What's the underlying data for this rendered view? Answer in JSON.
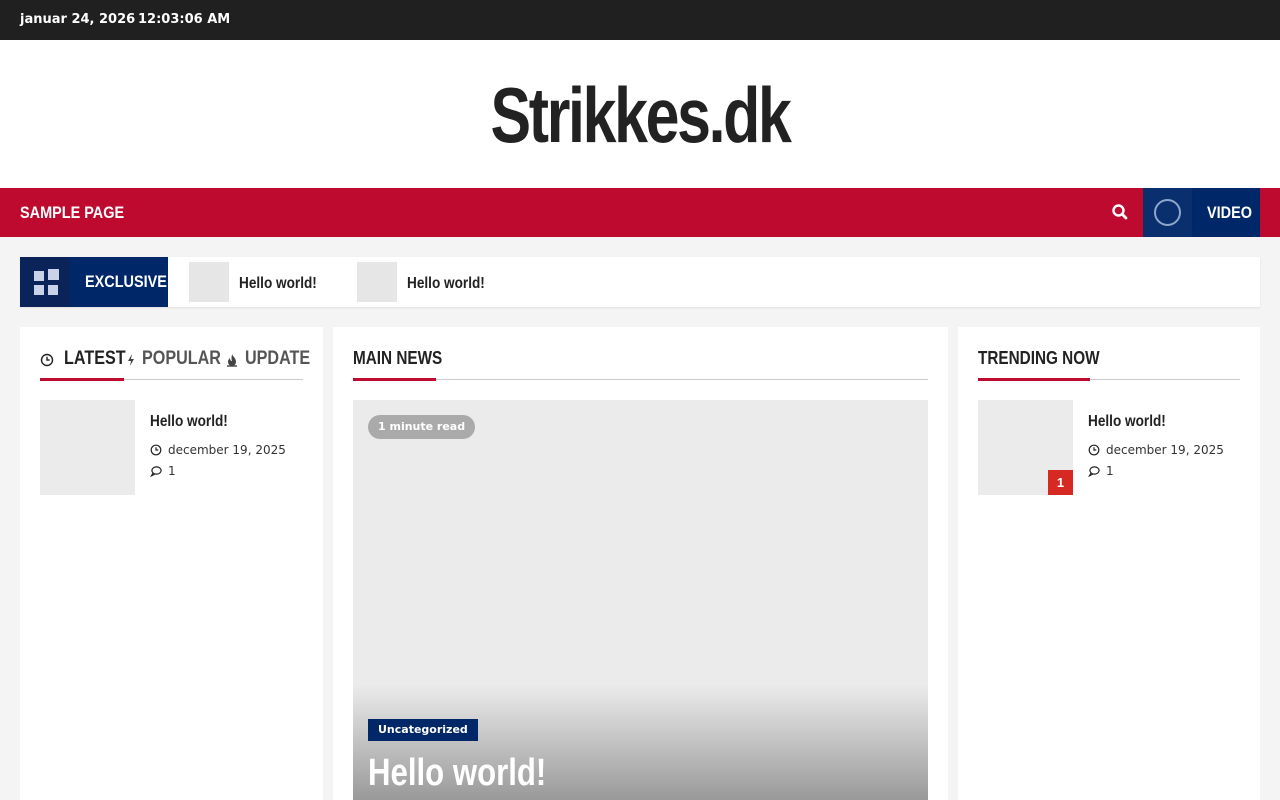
{
  "topbar": {
    "date": "januar 24, 2026",
    "time": "12:03:06 AM"
  },
  "site": {
    "title": "Strikkes.dk"
  },
  "nav": {
    "items": [
      {
        "label": "Sample Page"
      }
    ],
    "video_label": "VIDEO"
  },
  "ticker": {
    "label": "EXCLUSIVE",
    "items": [
      {
        "title": "Hello world!"
      },
      {
        "title": "Hello world!"
      }
    ]
  },
  "left_panel": {
    "tabs": [
      {
        "label": "LATEST"
      },
      {
        "label": "POPULAR"
      },
      {
        "label": "UPDATE"
      }
    ],
    "post": {
      "title": "Hello world!",
      "date": "december 19, 2025",
      "comments": "1"
    }
  },
  "main_panel": {
    "title": "Main News",
    "feature": {
      "read_time": "1 minute read",
      "category": "Uncategorized",
      "title": "Hello world!"
    }
  },
  "right_panel": {
    "title": "Trending Now",
    "post": {
      "rank": "1",
      "title": "Hello world!",
      "date": "december 19, 2025",
      "comments": "1"
    }
  },
  "colors": {
    "accent": "#bf0a30",
    "navy": "#002868",
    "topbar": "#202020",
    "badge_red": "#d72924"
  }
}
